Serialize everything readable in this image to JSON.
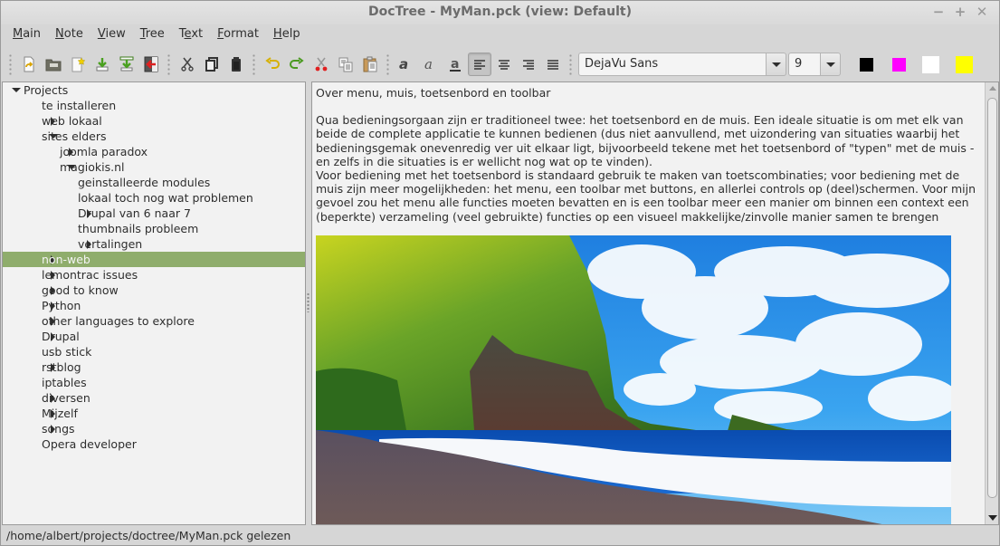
{
  "window": {
    "title": "DocTree - MyMan.pck (view: Default)",
    "controls": {
      "minimize": "−",
      "maximize": "+",
      "close": "✕"
    }
  },
  "menu": [
    {
      "label": "Main",
      "mnemonic": "M",
      "rest": "ain"
    },
    {
      "label": "Note",
      "mnemonic": "N",
      "rest": "ote"
    },
    {
      "label": "View",
      "mnemonic": "V",
      "rest": "iew"
    },
    {
      "label": "Tree",
      "mnemonic": "T",
      "rest": "ree"
    },
    {
      "label": "Text",
      "mnemonic": "e",
      "pre": "T",
      "rest": "xt"
    },
    {
      "label": "Format",
      "mnemonic": "F",
      "rest": "ormat"
    },
    {
      "label": "Help",
      "mnemonic": "H",
      "rest": "elp"
    }
  ],
  "toolbar": {
    "file_buttons": [
      "open-file-icon",
      "open-folder-icon",
      "new-file-icon",
      "import-icon",
      "import-tree-icon",
      "exit-icon"
    ],
    "edit_buttons": [
      "cut-icon",
      "copy-icon",
      "paste-icon"
    ],
    "text_buttons": [
      "undo-icon",
      "redo-icon",
      "cut-text-icon",
      "copy-text-icon",
      "paste-text-icon"
    ],
    "format_buttons": [
      "bold-icon",
      "italic-icon",
      "underline-icon",
      "align-left-icon",
      "align-center-icon",
      "align-right-icon",
      "justify-icon"
    ],
    "active_alignment": "align-left",
    "font_family": "DejaVu Sans",
    "font_size": "9",
    "colors": [
      {
        "name": "black",
        "hex": "#000000"
      },
      {
        "name": "magenta",
        "hex": "#ff00ff"
      },
      {
        "name": "white",
        "hex": "#ffffff"
      },
      {
        "name": "yellow",
        "hex": "#ffff00"
      }
    ]
  },
  "tree": {
    "selected": "non-web",
    "items": [
      {
        "label": "Projects",
        "level": 0,
        "expander": "open"
      },
      {
        "label": "te installeren",
        "level": 1,
        "expander": "none"
      },
      {
        "label": "web lokaal",
        "level": 1,
        "expander": "closed"
      },
      {
        "label": "sites elders",
        "level": 1,
        "expander": "open"
      },
      {
        "label": "joomla paradox",
        "level": 2,
        "expander": "closed"
      },
      {
        "label": "magiokis.nl",
        "level": 2,
        "expander": "open"
      },
      {
        "label": "geinstalleerde modules",
        "level": 3,
        "expander": "none"
      },
      {
        "label": "lokaal toch nog wat problemen",
        "level": 3,
        "expander": "none"
      },
      {
        "label": "Drupal van 6 naar 7",
        "level": 3,
        "expander": "closed"
      },
      {
        "label": "thumbnails probleem",
        "level": 3,
        "expander": "none"
      },
      {
        "label": "vertalingen",
        "level": 3,
        "expander": "closed"
      },
      {
        "label": "non-web",
        "level": 1,
        "expander": "closed",
        "selected": true
      },
      {
        "label": "lemontrac issues",
        "level": 1,
        "expander": "closed"
      },
      {
        "label": "good to know",
        "level": 1,
        "expander": "closed"
      },
      {
        "label": "Python",
        "level": 1,
        "expander": "closed"
      },
      {
        "label": "other languages to explore",
        "level": 1,
        "expander": "closed"
      },
      {
        "label": "Drupal",
        "level": 1,
        "expander": "closed"
      },
      {
        "label": "usb stick",
        "level": 1,
        "expander": "none"
      },
      {
        "label": "rstblog",
        "level": 1,
        "expander": "closed"
      },
      {
        "label": "iptables",
        "level": 1,
        "expander": "none"
      },
      {
        "label": "diversen",
        "level": 1,
        "expander": "closed"
      },
      {
        "label": "Mijzelf",
        "level": 1,
        "expander": "closed"
      },
      {
        "label": "songs",
        "level": 1,
        "expander": "closed"
      },
      {
        "label": "Opera developer",
        "level": 1,
        "expander": "none"
      }
    ]
  },
  "editor": {
    "heading": "Over menu, muis, toetsenbord en toolbar",
    "paragraph1": "Qua bedieningsorgaan zijn er traditioneel twee: het toetsenbord en de muis. Een ideale situatie is om met elk van beide de complete applicatie te kunnen bedienen (dus niet aanvullend, met uizondering van situaties waarbij het bedieningsgemak onevenredig ver uit elkaar ligt, bijvoorbeeld tekene met het toetsenbord of \"typen\" met de muis - en zelfs in die situaties is er wellicht nog wat op te vinden).",
    "paragraph2": "Voor bediening met het toetsenbord is standaard gebruik te maken van toetscombinaties; voor bediening met de muis zijn meer mogelijkheden: het menu, een toolbar met buttons, en allerlei controls op (deel)schermen. Voor mijn gevoel zou het menu alle functies moeten bevatten en is een toolbar meer een manier om binnen een context een (beperkte) verzameling (veel gebruikte) functies op een visueel makkelijke/zinvolle manier samen te brengen",
    "image": "coastal-cliff-beach-photo"
  },
  "statusbar": {
    "message": "/home/albert/projects/doctree/MyMan.pck gelezen"
  },
  "colors": {
    "selection": "#8fad6c",
    "pane_background": "#f2f2f2",
    "chrome_background": "#d6d6d6"
  }
}
